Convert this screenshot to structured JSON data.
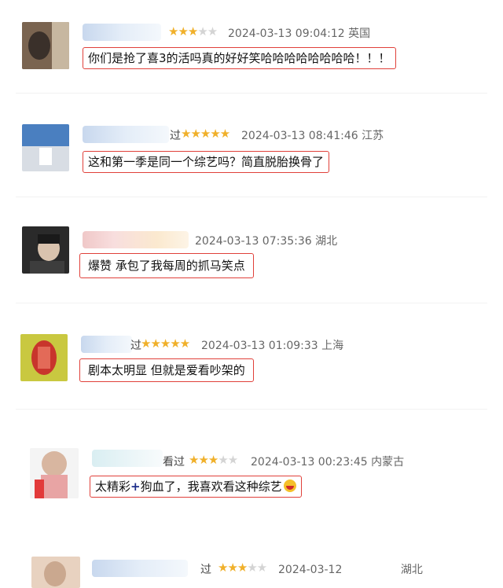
{
  "reviews": [
    {
      "label_fragment": "",
      "stars": 3,
      "date": "2024-03-13 09:04:12",
      "location": "英国",
      "comment": "你们是抢了喜3的活吗真的好好笑哈哈哈哈哈哈哈哈！！！"
    },
    {
      "label_fragment": "过",
      "stars": 5,
      "date": "2024-03-13 08:41:46",
      "location": "江苏",
      "comment": "这和第一季是同一个综艺吗？简直脱胎换骨了"
    },
    {
      "label_fragment": "",
      "stars": 0,
      "date": "2024-03-13 07:35:36",
      "location": "湖北",
      "comment": "爆赞 承包了我每周的抓马笑点"
    },
    {
      "label_fragment": "过",
      "stars": 5,
      "date": "2024-03-13 01:09:33",
      "location": "上海",
      "comment": "剧本太明显 但就是爱看吵架的"
    },
    {
      "label_fragment": "看过",
      "stars": 3,
      "date": "2024-03-13 00:23:45",
      "location": "内蒙古",
      "comment_part1": "太精彩",
      "comment_plus": "+",
      "comment_part2": "狗血了，我喜欢看这种综艺"
    },
    {
      "label_fragment": "过",
      "stars": 3,
      "date": "2024-03-12",
      "location": "湖北",
      "comment": ""
    }
  ],
  "colors": {
    "highlight_border": "#e0403a",
    "star": "#f0b02a"
  }
}
